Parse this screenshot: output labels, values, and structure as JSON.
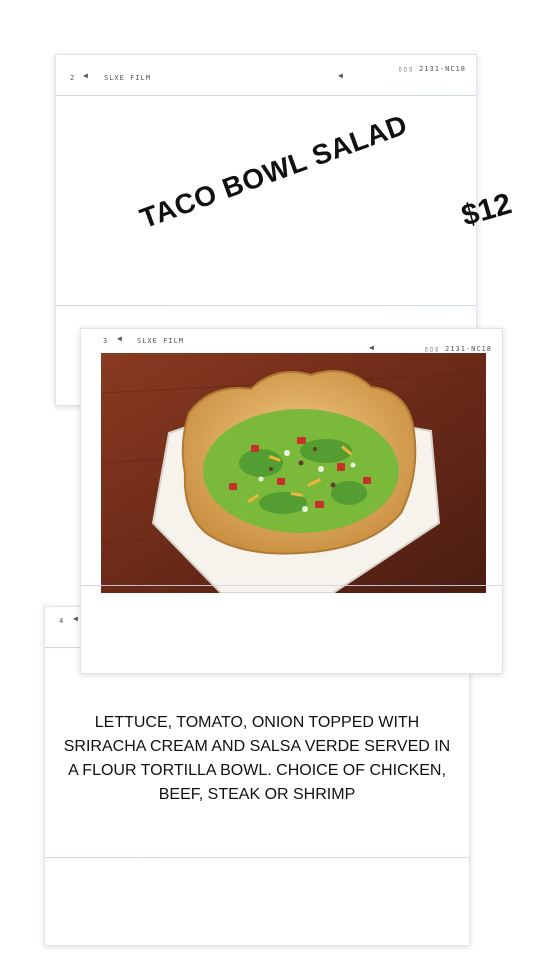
{
  "card_title": {
    "frame_number": "2",
    "film_name": "SLXE FILM",
    "code": "▯▯▯ 2131-NC18",
    "title": "TACO BOWL SALAD",
    "price": "$12"
  },
  "card_photo": {
    "frame_number": "3",
    "film_name": "SLXE FILM",
    "code": "▯▯▯ 2131-NC18"
  },
  "card_desc": {
    "frame_number": "4",
    "description": "LETTUCE, TOMATO, ONION TOPPED WITH SRIRACHA CREAM AND SALSA VERDE SERVED IN A FLOUR TORTILLA BOWL. CHOICE OF CHICKEN, BEEF, STEAK OR SHRIMP"
  },
  "colors": {
    "table_wood": "#6e2f1e",
    "plate": "#f7f3ee",
    "tortilla_bowl": "#d9a75b",
    "lettuce": "#78b83a",
    "salsa_verde": "#5aa33a",
    "tomato": "#c9302c",
    "cheese": "#f0b43a",
    "film_line": "#d9c8e6"
  }
}
